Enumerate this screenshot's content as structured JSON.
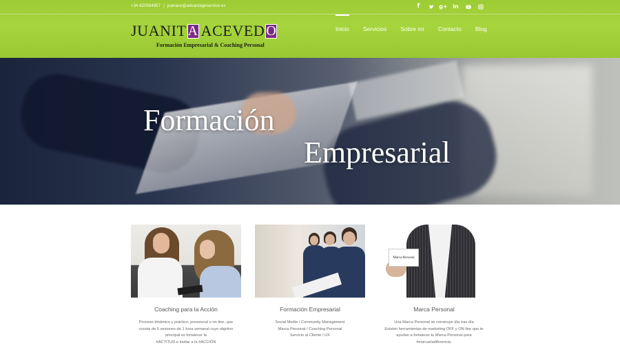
{
  "topbar": {
    "phone": "+34 620594957",
    "separator": "|",
    "email": "juanace@advantageservice.es",
    "social_icons": [
      "facebook-icon",
      "twitter-icon",
      "google-plus-icon",
      "linkedin-icon",
      "youtube-icon",
      "instagram-icon"
    ]
  },
  "logo": {
    "name_part1": "JUANIT",
    "name_box1": "A",
    "name_part2": "ACEVED",
    "name_box2": "O",
    "tagline": "Formación Empresarial & Coaching Personal"
  },
  "nav": {
    "items": [
      {
        "label": "Inicio",
        "active": true
      },
      {
        "label": "Servicios",
        "active": false
      },
      {
        "label": "Sobre mí",
        "active": false
      },
      {
        "label": "Contacto",
        "active": false
      },
      {
        "label": "Blog",
        "active": false
      }
    ]
  },
  "hero": {
    "line1": "Formación",
    "line2": "Empresarial"
  },
  "cards": [
    {
      "title": "Coaching para la Acción",
      "lines": [
        "Proceso dinámico y práctico, presencial u on-line, que",
        "consta de 5 sesiones de 1 hora semanal cuyo objetivo",
        "principal es fortalecer la",
        "#ACTITUD e invitar a la #ACCIÓN"
      ]
    },
    {
      "title": "Formación Empresarial",
      "lines": [
        "Social Media / Community Management",
        "Marca Personal / Coaching Personal",
        "Servicio al Cliente / UX"
      ]
    },
    {
      "title": "Marca Personal",
      "image_text": "Marca Personal",
      "lines": [
        "Una Marca Personal se construye día tras día",
        "Existen herramientas de marketing OFF y ON line que te",
        "ayudan a fortalecer tu Marca Personal para",
        "#marcarladiferencia."
      ]
    }
  ],
  "colors": {
    "header_green": "#a6d43d",
    "logo_purple": "#7a2a83"
  }
}
